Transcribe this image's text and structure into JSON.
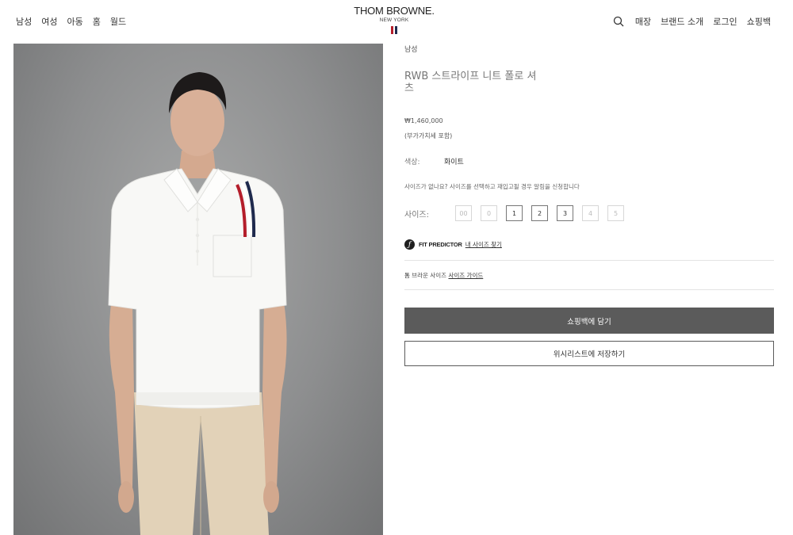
{
  "header": {
    "nav_left": [
      "남성",
      "여성",
      "아동",
      "홈",
      "월드"
    ],
    "brand": {
      "name": "THOM BROWNE.",
      "sub": "NEW YORK"
    },
    "nav_right": [
      "매장",
      "브랜드 소개",
      "로그인",
      "쇼핑백"
    ],
    "search_icon": "search-icon"
  },
  "product": {
    "category": "남성",
    "title_line1": "RWB 스트라이프 니트 폴로 셔",
    "title_line2": "츠",
    "price": "₩1,460,000",
    "vat_note": "(부가가치세 포함)",
    "color_label": "색상:",
    "color_value": "화이트",
    "restock_note": "사이즈가 없나요? 사이즈를 선택하고 재입고될 경우 알림을 신청합니다",
    "size_label": "사이즈:",
    "sizes": [
      {
        "label": "00",
        "available": false
      },
      {
        "label": "0",
        "available": false
      },
      {
        "label": "1",
        "available": true
      },
      {
        "label": "2",
        "available": true
      },
      {
        "label": "3",
        "available": true
      },
      {
        "label": "4",
        "available": false
      },
      {
        "label": "5",
        "available": false
      }
    ],
    "fit_predictor": {
      "title": "FIT PREDICTOR",
      "link": "내 사이즈 찾기"
    },
    "size_guide": {
      "prefix": "톰 브라운 사이즈",
      "link": "사이즈 가이드"
    },
    "add_to_bag": "쇼핑백에 담기",
    "save_wishlist": "위시리스트에 저장하기"
  },
  "colors": {
    "flag_blue": "#1f2a4d",
    "flag_white": "#ffffff",
    "flag_red": "#b41e2b",
    "button_dark": "#5b5b5b"
  }
}
